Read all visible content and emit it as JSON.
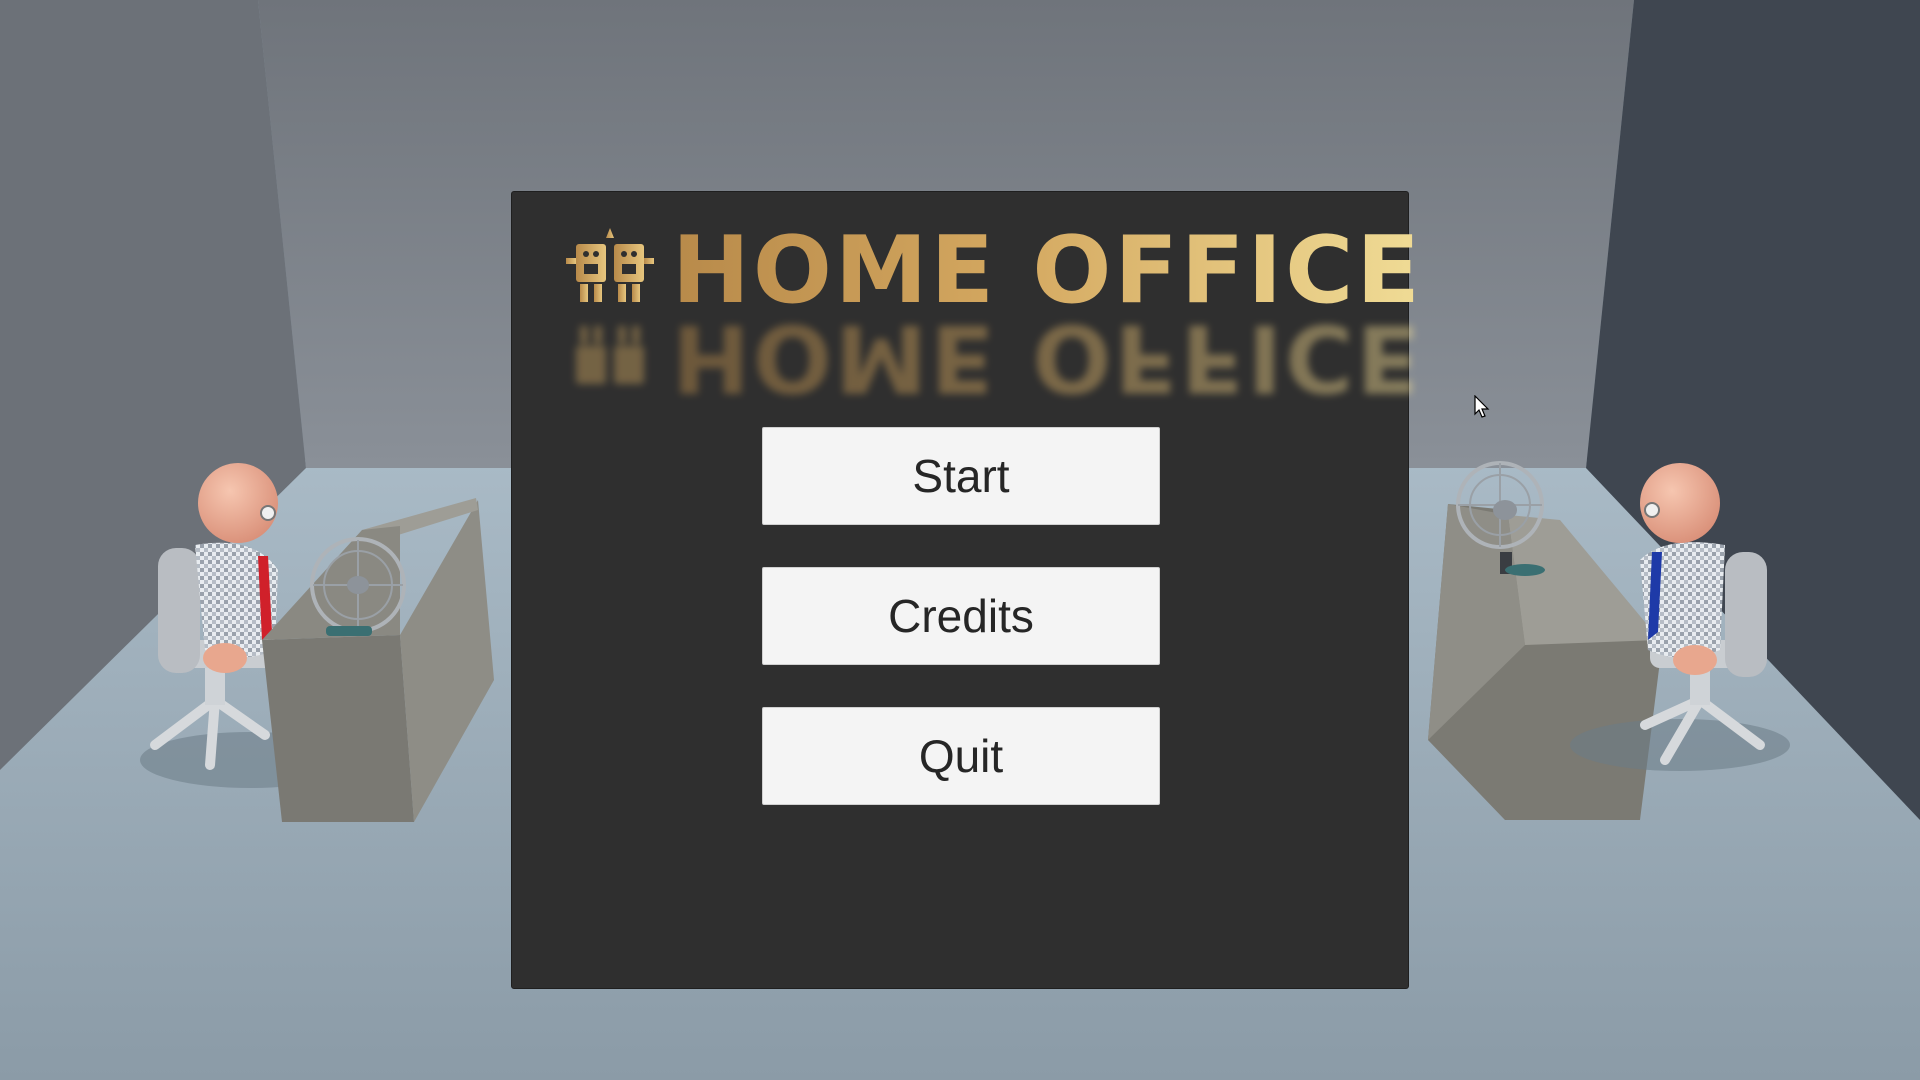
{
  "game": {
    "title": "HOME OFFICE",
    "logo_icon": "two-robots-emblem-icon"
  },
  "menu": {
    "start_label": "Start",
    "credits_label": "Credits",
    "quit_label": "Quit"
  },
  "scene": {
    "left_character_tie": "red",
    "right_character_tie": "blue",
    "props": [
      "office-desk",
      "desk-fan",
      "office-chair"
    ]
  },
  "colors": {
    "panel_bg": "#2f2f2f",
    "button_bg": "#f4f4f4",
    "title_gold_start": "#b88a4a",
    "title_gold_end": "#f0dc96"
  }
}
